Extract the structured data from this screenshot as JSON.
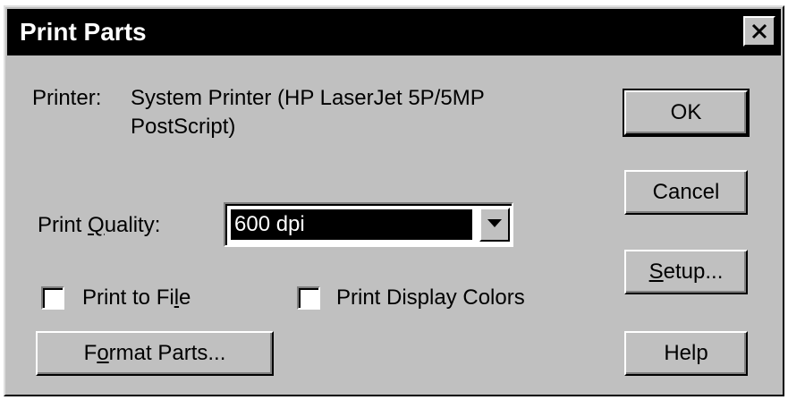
{
  "dialog": {
    "title": "Print Parts",
    "close_icon": "close-icon"
  },
  "printer": {
    "label": "Printer:",
    "value_line1": "System Printer (HP LaserJet 5P/5MP",
    "value_line2": "PostScript)"
  },
  "print_quality": {
    "label_before": "Print ",
    "label_mnemonic": "Q",
    "label_after": "uality:",
    "selected": "600 dpi",
    "arrow_icon": "chevron-down-icon"
  },
  "options": {
    "print_to_file_before": "Print to Fi",
    "print_to_file_mnemonic": "l",
    "print_to_file_after": "e",
    "print_to_file_checked": false,
    "print_display_colors": "Print Display Colors",
    "print_display_colors_checked": false
  },
  "format_button": {
    "before": "F",
    "mnemonic": "o",
    "after": "rmat Parts..."
  },
  "buttons": {
    "ok": "OK",
    "cancel": "Cancel",
    "setup_mnemonic": "S",
    "setup_after": "etup...",
    "help": "Help"
  },
  "colors": {
    "face": "#c0c0c0",
    "titlebar": "#000000",
    "selection": "#000000"
  }
}
